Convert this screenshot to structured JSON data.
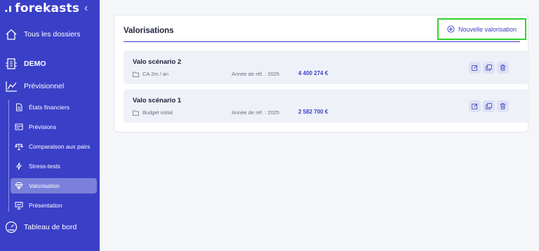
{
  "app": {
    "name": "forekasts",
    "collapse_icon": "chevron-left-icon"
  },
  "sidebar": {
    "all_folders": "Tous les dossiers",
    "workspace": "DEMO",
    "section": "Prévisionnel",
    "items": [
      {
        "label": "États financiers",
        "icon": "document-icon",
        "active": false
      },
      {
        "label": "Prévisions",
        "icon": "forecast-icon",
        "active": false
      },
      {
        "label": "Comparaison aux pairs",
        "icon": "scales-icon",
        "active": false
      },
      {
        "label": "Stress-tests",
        "icon": "lightning-icon",
        "active": false
      },
      {
        "label": "Valorisation",
        "icon": "diamond-icon",
        "active": true
      },
      {
        "label": "Présentation",
        "icon": "presentation-icon",
        "active": false
      }
    ],
    "dashboard": "Tableau de bord"
  },
  "main": {
    "title": "Valorisations",
    "add_button": "Nouvelle valorisation",
    "rows": [
      {
        "name": "Valo scénario 2",
        "meta": "CA 2m / an",
        "year": "Année de réf. : 2025",
        "value": "4 400 274 €"
      },
      {
        "name": "Valo scénario 1",
        "meta": "Budget initial",
        "year": "Année de réf. : 2025",
        "value": "2 582 700 €"
      }
    ]
  },
  "colors": {
    "sidebar": "#3a3fc8",
    "accent": "#3a3fc8",
    "highlight": "#31d42a"
  }
}
